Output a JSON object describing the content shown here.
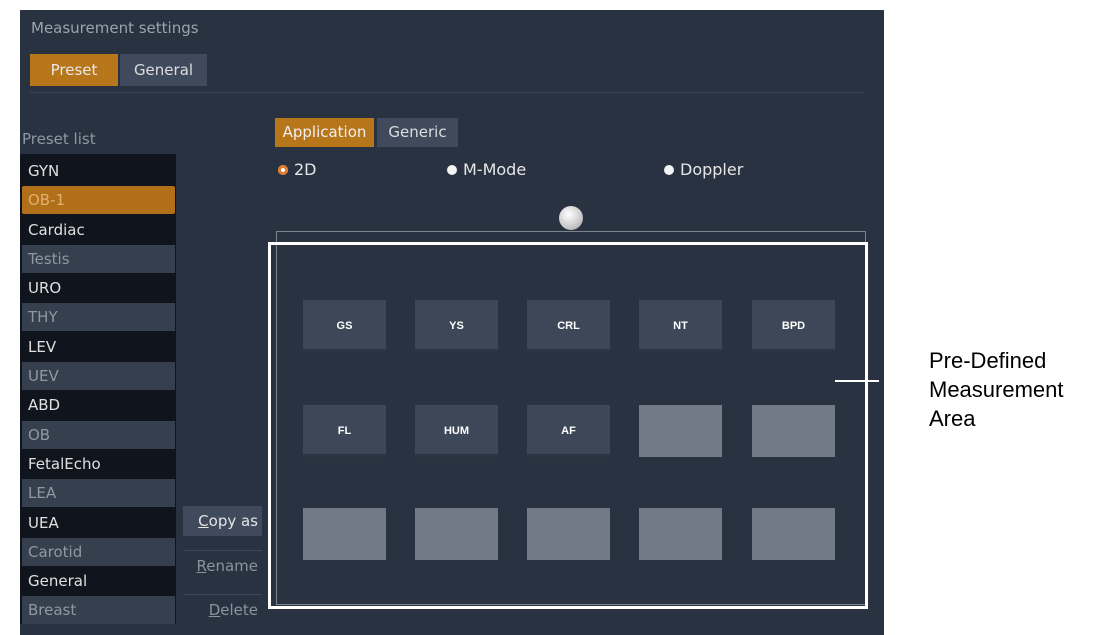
{
  "window": {
    "title": "Measurement settings"
  },
  "tabs": [
    {
      "label": "Preset",
      "active": true
    },
    {
      "label": "General",
      "active": false
    }
  ],
  "preset_list": {
    "label": "Preset list",
    "items": [
      "GYN",
      "OB-1",
      "Cardiac",
      "Testis",
      "URO",
      "THY",
      "LEV",
      "UEV",
      "ABD",
      "OB",
      "FetalEcho",
      "LEA",
      "UEA",
      "Carotid",
      "General",
      "Breast"
    ],
    "selected": "OB-1"
  },
  "actions": {
    "copy_as_prefix": "C",
    "copy_as_rest": "opy as",
    "rename_prefix": "R",
    "rename_rest": "ename",
    "delete_prefix": "D",
    "delete_rest": "elete"
  },
  "subtabs": [
    {
      "label": "Application",
      "active": true
    },
    {
      "label": "Generic",
      "active": false
    }
  ],
  "modes": [
    {
      "label": "2D",
      "selected": true
    },
    {
      "label": "M-Mode",
      "selected": false
    },
    {
      "label": "Doppler",
      "selected": false
    }
  ],
  "measurement_buttons": {
    "row1": [
      "GS",
      "YS",
      "CRL",
      "NT",
      "BPD"
    ],
    "row2": [
      "FL",
      "HUM",
      "AF",
      "",
      ""
    ],
    "row3": [
      "",
      "",
      "",
      "",
      ""
    ]
  },
  "callout": {
    "lines": [
      "Pre-Defined",
      "Measurement",
      "Area"
    ]
  },
  "colors": {
    "accent": "#b8761a",
    "panel": "#283241",
    "list_bg": "#0f141d"
  }
}
